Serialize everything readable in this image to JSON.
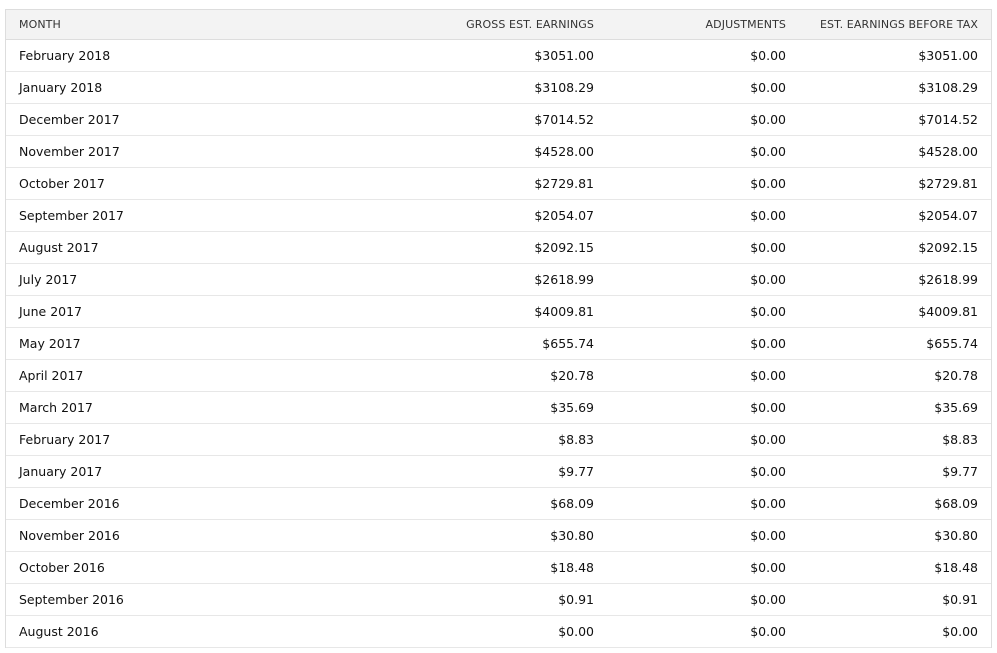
{
  "table": {
    "headers": {
      "month": "MONTH",
      "gross": "GROSS EST. EARNINGS",
      "adjustments": "ADJUSTMENTS",
      "est_before_tax": "EST. EARNINGS BEFORE TAX"
    },
    "rows": [
      {
        "month": "February 2018",
        "gross": "$3051.00",
        "adjustments": "$0.00",
        "est_before_tax": "$3051.00"
      },
      {
        "month": "January 2018",
        "gross": "$3108.29",
        "adjustments": "$0.00",
        "est_before_tax": "$3108.29"
      },
      {
        "month": "December 2017",
        "gross": "$7014.52",
        "adjustments": "$0.00",
        "est_before_tax": "$7014.52"
      },
      {
        "month": "November 2017",
        "gross": "$4528.00",
        "adjustments": "$0.00",
        "est_before_tax": "$4528.00"
      },
      {
        "month": "October 2017",
        "gross": "$2729.81",
        "adjustments": "$0.00",
        "est_before_tax": "$2729.81"
      },
      {
        "month": "September 2017",
        "gross": "$2054.07",
        "adjustments": "$0.00",
        "est_before_tax": "$2054.07"
      },
      {
        "month": "August 2017",
        "gross": "$2092.15",
        "adjustments": "$0.00",
        "est_before_tax": "$2092.15"
      },
      {
        "month": "July 2017",
        "gross": "$2618.99",
        "adjustments": "$0.00",
        "est_before_tax": "$2618.99"
      },
      {
        "month": "June 2017",
        "gross": "$4009.81",
        "adjustments": "$0.00",
        "est_before_tax": "$4009.81"
      },
      {
        "month": "May 2017",
        "gross": "$655.74",
        "adjustments": "$0.00",
        "est_before_tax": "$655.74"
      },
      {
        "month": "April 2017",
        "gross": "$20.78",
        "adjustments": "$0.00",
        "est_before_tax": "$20.78"
      },
      {
        "month": "March 2017",
        "gross": "$35.69",
        "adjustments": "$0.00",
        "est_before_tax": "$35.69"
      },
      {
        "month": "February 2017",
        "gross": "$8.83",
        "adjustments": "$0.00",
        "est_before_tax": "$8.83"
      },
      {
        "month": "January 2017",
        "gross": "$9.77",
        "adjustments": "$0.00",
        "est_before_tax": "$9.77"
      },
      {
        "month": "December 2016",
        "gross": "$68.09",
        "adjustments": "$0.00",
        "est_before_tax": "$68.09"
      },
      {
        "month": "November 2016",
        "gross": "$30.80",
        "adjustments": "$0.00",
        "est_before_tax": "$30.80"
      },
      {
        "month": "October 2016",
        "gross": "$18.48",
        "adjustments": "$0.00",
        "est_before_tax": "$18.48"
      },
      {
        "month": "September 2016",
        "gross": "$0.91",
        "adjustments": "$0.00",
        "est_before_tax": "$0.91"
      },
      {
        "month": "August 2016",
        "gross": "$0.00",
        "adjustments": "$0.00",
        "est_before_tax": "$0.00"
      }
    ]
  }
}
